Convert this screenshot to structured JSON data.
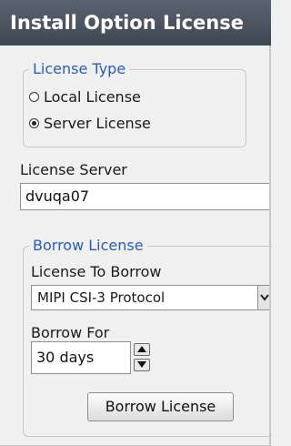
{
  "dialog": {
    "title": "Install Option License"
  },
  "license_type": {
    "legend": "License Type",
    "options": [
      {
        "label": "Local License",
        "selected": false
      },
      {
        "label": "Server License",
        "selected": true
      }
    ]
  },
  "license_server": {
    "label": "License Server",
    "value": "dvuqa07"
  },
  "borrow": {
    "legend": "Borrow License",
    "license_to_borrow_label": "License To Borrow",
    "license_to_borrow_value": "MIPI CSI-3 Protocol",
    "borrow_for_label": "Borrow For",
    "borrow_for_value": "30 days",
    "button_label": "Borrow License"
  },
  "icons": {
    "dropdown": "chevron-down-icon",
    "spin_up": "triangle-up-icon",
    "spin_down": "triangle-down-icon"
  },
  "colors": {
    "title_bar": "#4a525c",
    "legend_text": "#2a5db0",
    "background": "#f0f0f0"
  }
}
